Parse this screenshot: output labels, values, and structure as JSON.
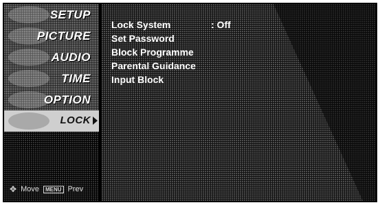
{
  "menu": {
    "items": [
      {
        "label": "SETUP",
        "icon": "setup-icon"
      },
      {
        "label": "PICTURE",
        "icon": "picture-icon"
      },
      {
        "label": "AUDIO",
        "icon": "audio-icon"
      },
      {
        "label": "TIME",
        "icon": "time-icon"
      },
      {
        "label": "OPTION",
        "icon": "option-icon"
      },
      {
        "label": "LOCK",
        "icon": "lock-icon",
        "selected": true
      }
    ],
    "footer": {
      "move_label": "Move",
      "menu_key": "MENU",
      "prev_label": "Prev"
    }
  },
  "lock_menu": {
    "items": [
      {
        "label": "Lock System",
        "value": ": Off"
      },
      {
        "label": "Set Password"
      },
      {
        "label": "Block Programme"
      },
      {
        "label": "Parental Guidance"
      },
      {
        "label": "Input Block"
      }
    ]
  }
}
